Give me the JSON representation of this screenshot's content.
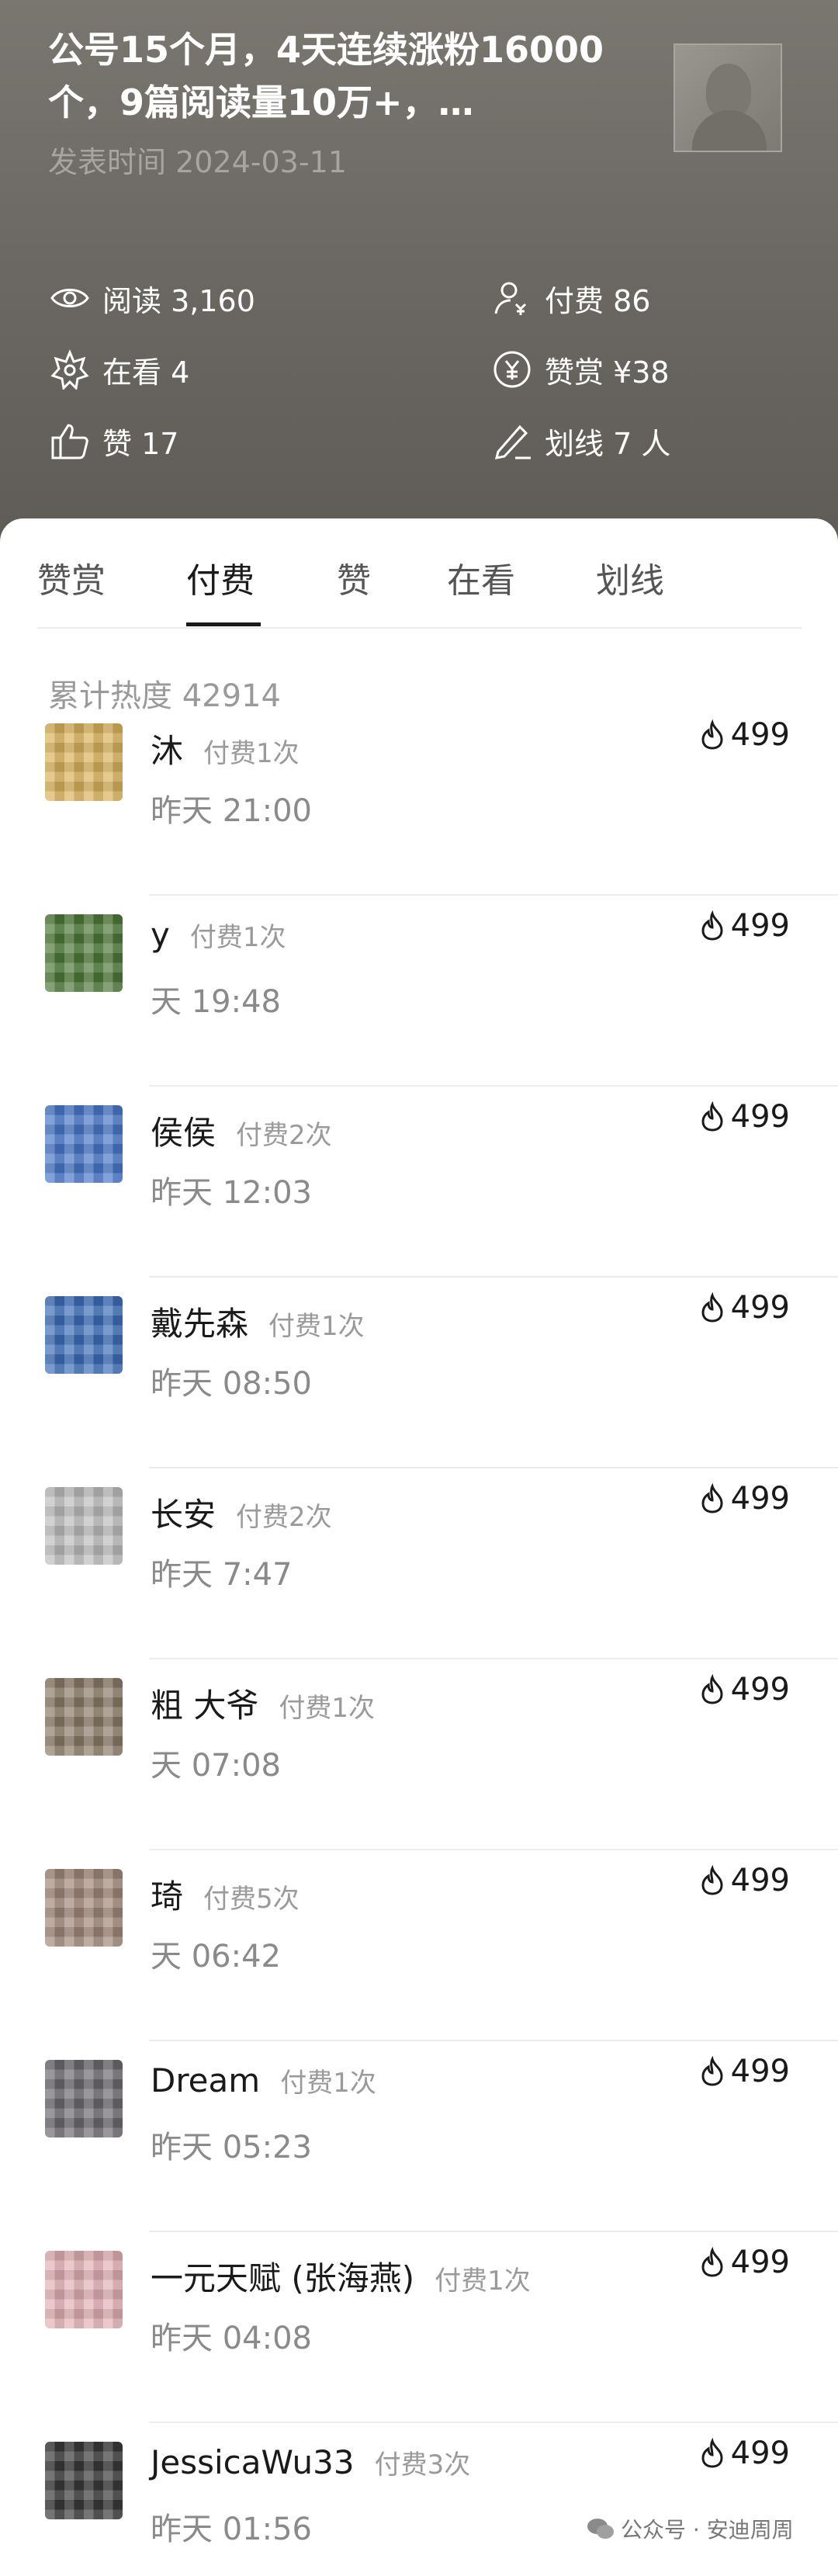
{
  "article": {
    "title": "公号15个月，4天连续涨粉16000个，9篇阅读量10万+，…",
    "publish_time": "发表时间 2024-03-11"
  },
  "stats": {
    "read": "阅读 3,160",
    "paid": "付费 86",
    "looking": "在看 4",
    "reward": "赞赏 ¥38",
    "like": "赞 17",
    "underline": "划线 7 人"
  },
  "tabs": [
    "赞赏",
    "付费",
    "赞",
    "在看",
    "划线"
  ],
  "active_tab": "付费",
  "heat_total": "累计热度 42914",
  "payments": [
    {
      "name": "沐",
      "count": "付费1次",
      "time": "昨天 21:00",
      "heat": "499",
      "avatar_color": "#d9b25c"
    },
    {
      "name": "y",
      "count": "付费1次",
      "time": "天 19:48",
      "heat": "499",
      "avatar_color": "#4f7a3a"
    },
    {
      "name": "侯侯",
      "count": "付费2次",
      "time": "昨天 12:03",
      "heat": "499",
      "avatar_color": "#4a78c8"
    },
    {
      "name": "戴先森",
      "count": "付费1次",
      "time": "昨天 08:50",
      "heat": "499",
      "avatar_color": "#3e6eb8"
    },
    {
      "name": "长安",
      "count": "付费2次",
      "time": "昨天 7:47",
      "heat": "499",
      "avatar_color": "#bdbdbd"
    },
    {
      "name": "粗 大爷",
      "count": "付费1次",
      "time": "天 07:08",
      "heat": "499",
      "avatar_color": "#8b7b68"
    },
    {
      "name": "琦",
      "count": "付费5次",
      "time": "天 06:42",
      "heat": "499",
      "avatar_color": "#a0887a"
    },
    {
      "name": "Dream",
      "count": "付费1次",
      "time": "昨天 05:23",
      "heat": "499",
      "avatar_color": "#6c6a70"
    },
    {
      "name": "一元天赋 (张海燕)",
      "count": "付费1次",
      "time": "昨天 04:08",
      "heat": "499",
      "avatar_color": "#e2b0b4"
    },
    {
      "name": "JessicaWu33",
      "count": "付费3次",
      "time": "昨天 01:56",
      "heat": "499",
      "avatar_color": "#3a3a3a"
    }
  ],
  "watermark": "公众号 · 安迪周周"
}
